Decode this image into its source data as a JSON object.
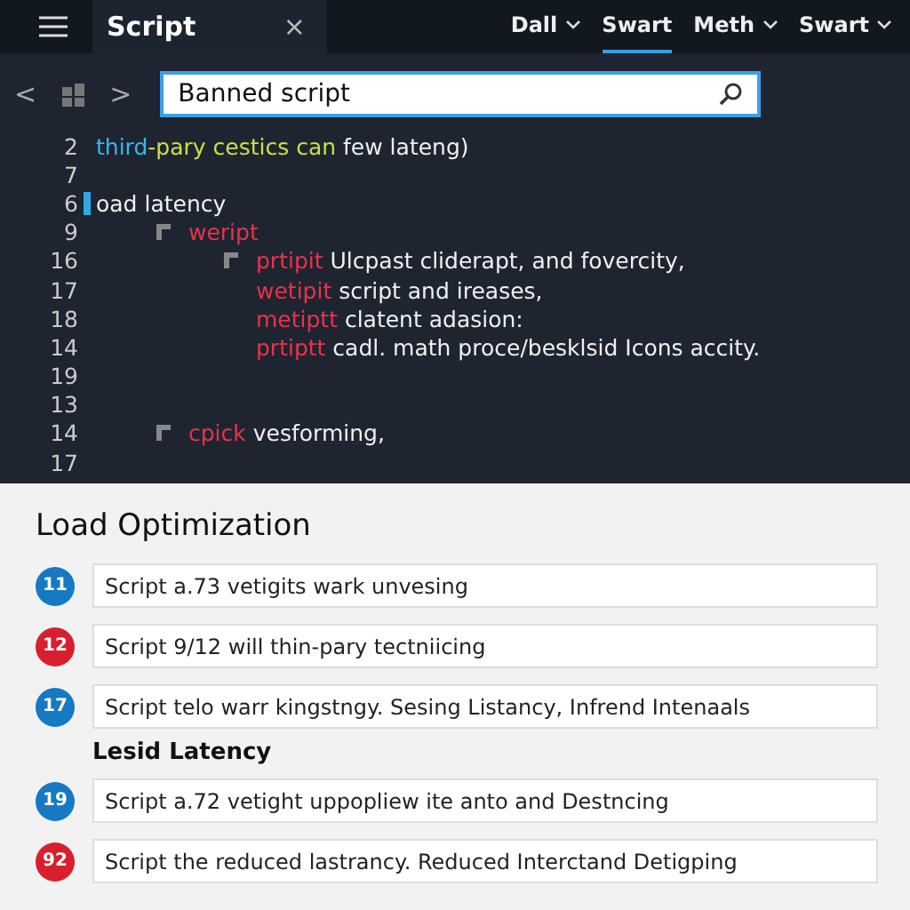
{
  "top_bar": {
    "tab": {
      "title": "Script",
      "close": "×"
    },
    "nav": [
      {
        "label": "Dall",
        "selected": false,
        "dropdown": true
      },
      {
        "label": "Swart",
        "selected": true,
        "dropdown": false
      },
      {
        "label": "Meth",
        "selected": false,
        "dropdown": true
      },
      {
        "label": "Swart",
        "selected": false,
        "dropdown": true
      }
    ]
  },
  "toolbar": {
    "back": "<",
    "forward": ">",
    "search": {
      "value": "Banned script"
    }
  },
  "code_lines": [
    {
      "number": "2",
      "fold": false,
      "cursor": false,
      "tokens": [
        {
          "text": "third",
          "kind": "type"
        },
        {
          "text": "-pary cestics can",
          "kind": "string"
        },
        {
          "text": " few lateng)",
          "kind": "plain"
        }
      ]
    },
    {
      "number": "7",
      "fold": false,
      "cursor": false
    },
    {
      "number": "6",
      "fold": false,
      "cursor": true,
      "tokens": [
        {
          "text": "oad latency",
          "kind": "plain"
        }
      ],
      "children": [
        {
          "number": "9",
          "fold": true,
          "cursor": false,
          "tokens": [
            {
              "text": "weript",
              "kind": "keyword"
            }
          ],
          "children": [
            {
              "number": "16",
              "fold": true,
              "cursor": false,
              "tokens": [
                {
                  "text": "prtipit",
                  "kind": "keyword"
                },
                {
                  "text": " Ulcpast cliderapt, and fovercity,",
                  "kind": "plain"
                }
              ]
            },
            {
              "number": "17",
              "fold": false,
              "cursor": false,
              "tokens": [
                {
                  "text": "wetipit",
                  "kind": "keyword"
                },
                {
                  "text": " script and ireases,",
                  "kind": "plain"
                }
              ]
            },
            {
              "number": "18",
              "fold": false,
              "cursor": false,
              "tokens": [
                {
                  "text": "metiptt",
                  "kind": "keyword"
                },
                {
                  "text": " clatent adasion:",
                  "kind": "plain"
                }
              ]
            },
            {
              "number": "14",
              "fold": false,
              "cursor": false,
              "tokens": [
                {
                  "text": "prtiptt",
                  "kind": "keyword"
                },
                {
                  "text": " cadl. math proce/besklsid Icons accity.",
                  "kind": "plain"
                }
              ]
            },
            {
              "number": "19",
              "fold": false,
              "cursor": false
            },
            {
              "number": "13",
              "fold": false,
              "cursor": false
            }
          ]
        },
        {
          "number": "14",
          "fold": true,
          "cursor": false,
          "tokens": [
            {
              "text": "cpick",
              "kind": "keyword"
            },
            {
              "text": " vesforming,",
              "kind": "plain"
            }
          ]
        },
        {
          "number": "17",
          "fold": false,
          "cursor": false
        }
      ]
    }
  ],
  "panel": {
    "sections": [
      {
        "heading": "Load Optimization",
        "kind": "title",
        "items": [
          {
            "badge": "11",
            "color": "#1679c4",
            "text": "Script a.73 vetigits wark unvesing"
          },
          {
            "badge": "12",
            "color": "#d91f2e",
            "text": "Script 9/12 will thin-pary tectniicing"
          },
          {
            "badge": "17",
            "color": "#1679c4",
            "text": "Script telo warr kingstngy. Sesing Listancy, Infrend Intenaals"
          }
        ]
      },
      {
        "heading": "Lesid Latency",
        "kind": "subtitle",
        "items": [
          {
            "badge": "19",
            "color": "#1679c4",
            "text": "Script a.72 vetight uppopliew ite anto and Destncing"
          },
          {
            "badge": "92",
            "color": "#d91f2e",
            "text": "Script the reduced lastrancy. Reduced Interctand Detigping"
          }
        ]
      }
    ]
  }
}
